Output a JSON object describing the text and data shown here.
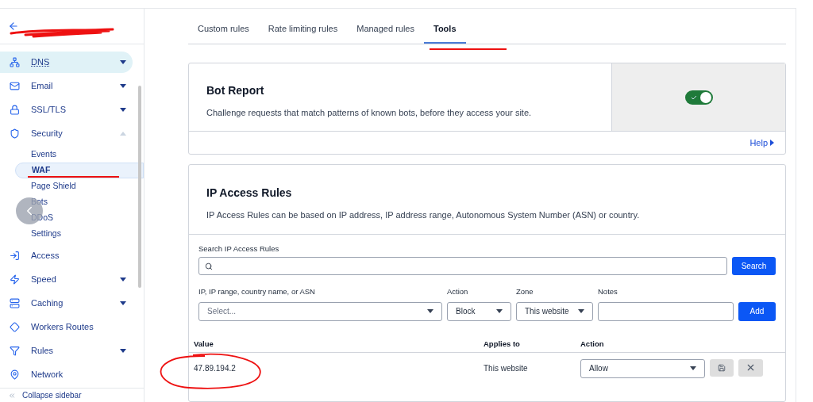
{
  "sidebar": {
    "items": [
      {
        "label": "DNS",
        "selected": true,
        "expanded": false
      },
      {
        "label": "Email",
        "selected": false,
        "expanded": false
      },
      {
        "label": "SSL/TLS",
        "selected": false,
        "expanded": false
      },
      {
        "label": "Security",
        "selected": false,
        "expanded": true,
        "children": [
          {
            "label": "Events",
            "selected": false
          },
          {
            "label": "WAF",
            "selected": true
          },
          {
            "label": "Page Shield",
            "selected": false
          },
          {
            "label": "Bots",
            "selected": false
          },
          {
            "label": "DDoS",
            "selected": false
          },
          {
            "label": "Settings",
            "selected": false
          }
        ]
      },
      {
        "label": "Access",
        "selected": false
      },
      {
        "label": "Speed",
        "selected": false,
        "expanded": false
      },
      {
        "label": "Caching",
        "selected": false,
        "expanded": false
      },
      {
        "label": "Workers Routes",
        "selected": false
      },
      {
        "label": "Rules",
        "selected": false,
        "expanded": false
      },
      {
        "label": "Network",
        "selected": false
      }
    ],
    "collapse": "Collapse sidebar"
  },
  "tabs": [
    {
      "label": "Custom rules",
      "selected": false
    },
    {
      "label": "Rate limiting rules",
      "selected": false
    },
    {
      "label": "Managed rules",
      "selected": false
    },
    {
      "label": "Tools",
      "selected": true
    }
  ],
  "bot_report": {
    "title": "Bot Report",
    "description": "Challenge requests that match patterns of known bots, before they access your site.",
    "on": true,
    "help": "Help"
  },
  "ip_access": {
    "title": "IP Access Rules",
    "description": "IP Access Rules can be based on IP address, IP address range, Autonomous System Number (ASN) or country.",
    "search_label": "Search IP Access Rules",
    "search_button": "Search",
    "fields": [
      {
        "label": "IP, IP range, country name, or ASN",
        "placeholder": "Select..."
      },
      {
        "label": "Action",
        "value": "Block"
      },
      {
        "label": "Zone",
        "value": "This website"
      },
      {
        "label": "Notes"
      }
    ],
    "add_button": "Add",
    "columns": [
      "Value",
      "Applies to",
      "Action"
    ],
    "rows": [
      {
        "value": "47.89.194.2",
        "applies_to": "This website",
        "action": "Allow"
      }
    ]
  }
}
